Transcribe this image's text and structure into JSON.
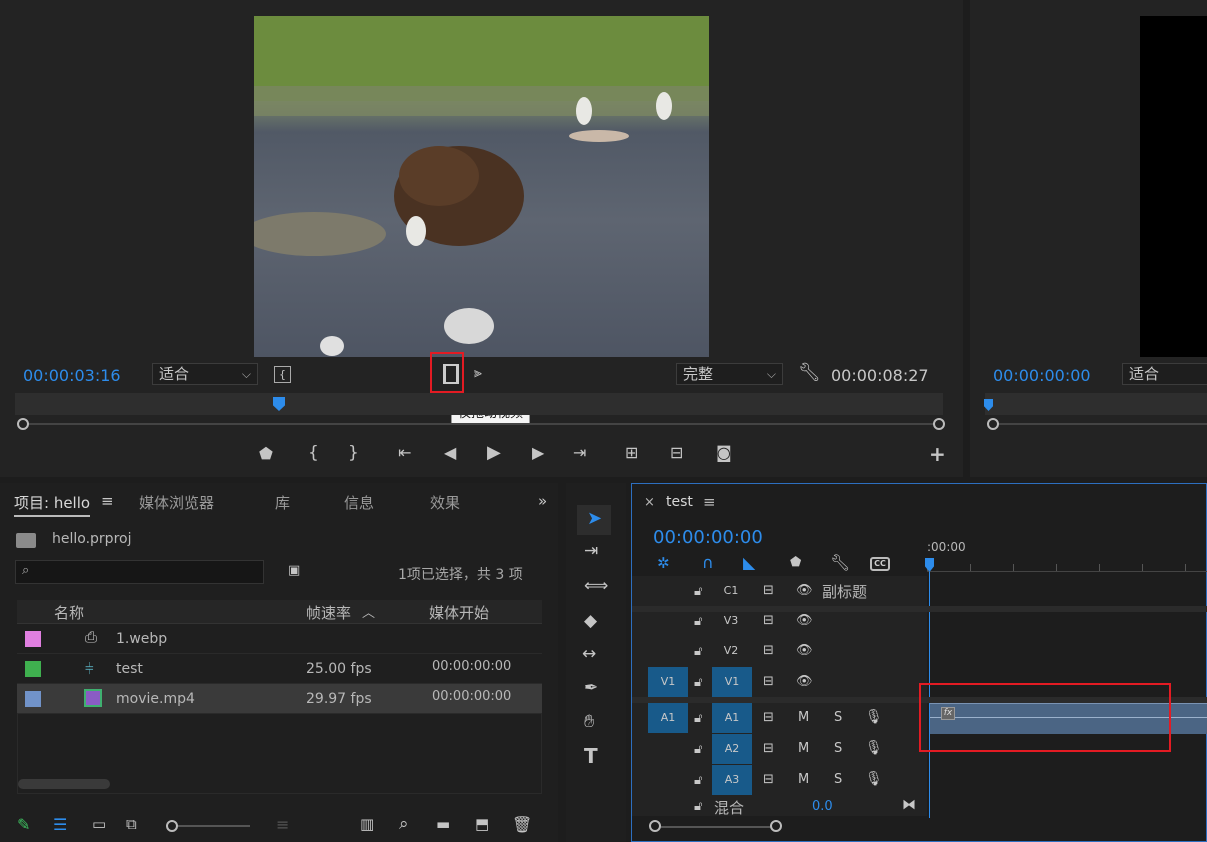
{
  "source_monitor": {
    "timecode_in": "00:00:03:16",
    "zoom": "适合",
    "quality": "完整",
    "duration": "00:00:08:27",
    "tooltip": "仅拖动视频",
    "icons": [
      "bracket-in-icon",
      "film-drag-icon",
      "audio-drag-icon",
      "wrench-icon",
      "marker-icon",
      "mark-in-icon",
      "mark-out-icon",
      "go-to-in-icon",
      "step-back-icon",
      "play-icon",
      "step-forward-icon",
      "go-to-out-icon",
      "insert-icon",
      "overwrite-icon",
      "camera-icon",
      "plus-icon"
    ]
  },
  "program_monitor": {
    "timecode": "00:00:00:00",
    "zoom": "适合"
  },
  "project_panel": {
    "tabs": [
      "项目: hello",
      "媒体浏览器",
      "库",
      "信息",
      "效果"
    ],
    "project_file": "hello.prproj",
    "selection_status": "1项已选择，共 3 项",
    "columns": [
      "名称",
      "帧速率",
      "媒体开始"
    ],
    "items": [
      {
        "name": "1.webp",
        "fps": "",
        "start": "",
        "color": "#e07fe0"
      },
      {
        "name": "test",
        "fps": "25.00 fps",
        "start": "00:00:00:00",
        "color": "#3fb04f"
      },
      {
        "name": "movie.mp4",
        "fps": "29.97 fps",
        "start": "00:00:00:00",
        "color": "#7193c9"
      }
    ]
  },
  "timeline": {
    "tab": "test",
    "timecode": "00:00:00:00",
    "ruler_label": ":00:00",
    "caption_track": "副标题",
    "tracks_video": [
      "C1",
      "V3",
      "V2",
      "V1"
    ],
    "tracks_audio": [
      "A1",
      "A2",
      "A3"
    ],
    "source_v": "V1",
    "source_a": "A1",
    "mix_label": "混合",
    "mix_value": "0.0",
    "mute": "M",
    "solo": "S",
    "fx": "fx"
  }
}
